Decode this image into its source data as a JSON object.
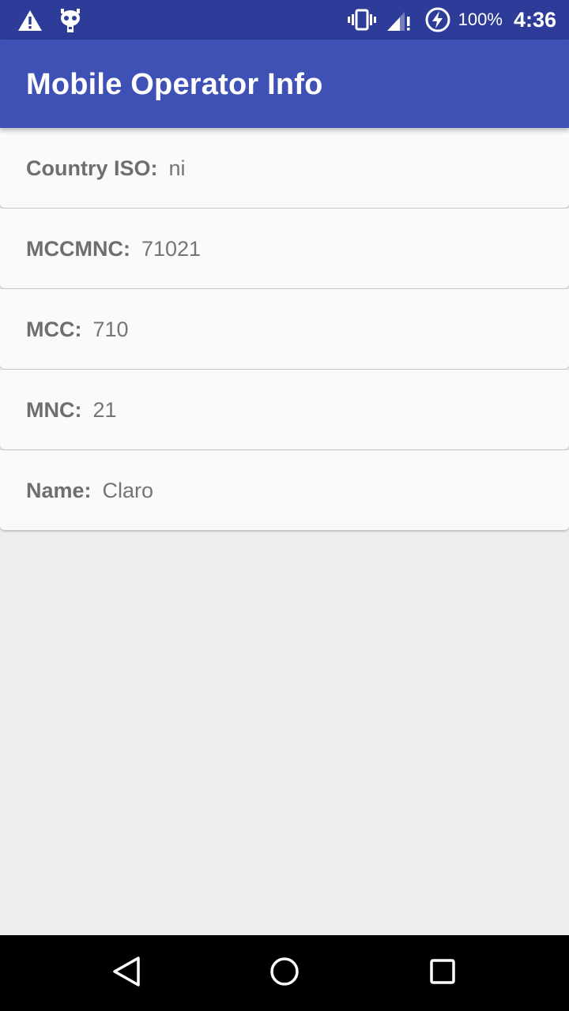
{
  "status_bar": {
    "left_icons": [
      "warning-icon",
      "cyanogen-mascot-icon"
    ],
    "right_icons": [
      "vibrate-icon",
      "signal-icon",
      "battery-charging-icon"
    ],
    "battery_text": "100%",
    "time": "4:36"
  },
  "app_bar": {
    "title": "Mobile Operator Info",
    "color": "#3F51B5",
    "status_color": "#2E3C99"
  },
  "items": [
    {
      "label": "Country ISO:",
      "value": "ni"
    },
    {
      "label": "MCCMNC:",
      "value": "71021"
    },
    {
      "label": "MCC:",
      "value": "710"
    },
    {
      "label": "MNC:",
      "value": "21"
    },
    {
      "label": "Name:",
      "value": "Claro"
    }
  ],
  "nav_bar": {
    "buttons": [
      "back-icon",
      "home-icon",
      "recents-icon"
    ]
  }
}
